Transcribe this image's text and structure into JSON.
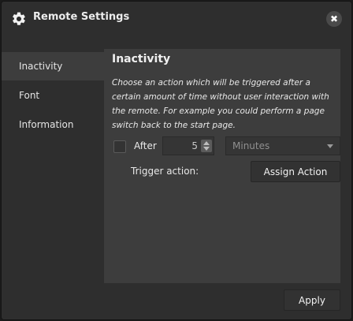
{
  "window": {
    "title": "Remote Settings",
    "close_label": "✖"
  },
  "icons": {
    "title_icon": "gear-icon",
    "close": "close-icon",
    "spinner": "spinner-arrows-icon",
    "dropdown": "chevron-down-icon"
  },
  "sidebar": {
    "items": [
      {
        "label": "Inactivity",
        "active": true
      },
      {
        "label": "Font",
        "active": false
      },
      {
        "label": "Information",
        "active": false
      }
    ]
  },
  "content": {
    "title": "Inactivity",
    "description": "Choose an action which will be triggered after a certain amount of time without user interaction with the remote. For example you could perform a page switch back to the start page.",
    "after_label": "After",
    "after_checked": false,
    "after_value": "5",
    "unit_value": "Minutes",
    "trigger_label": "Trigger action:",
    "assign_label": "Assign Action"
  },
  "footer": {
    "apply_label": "Apply"
  },
  "colors": {
    "window_bg": "#2e2e2e",
    "panel_bg": "#3d3d3d",
    "text": "#e8e8e8"
  }
}
